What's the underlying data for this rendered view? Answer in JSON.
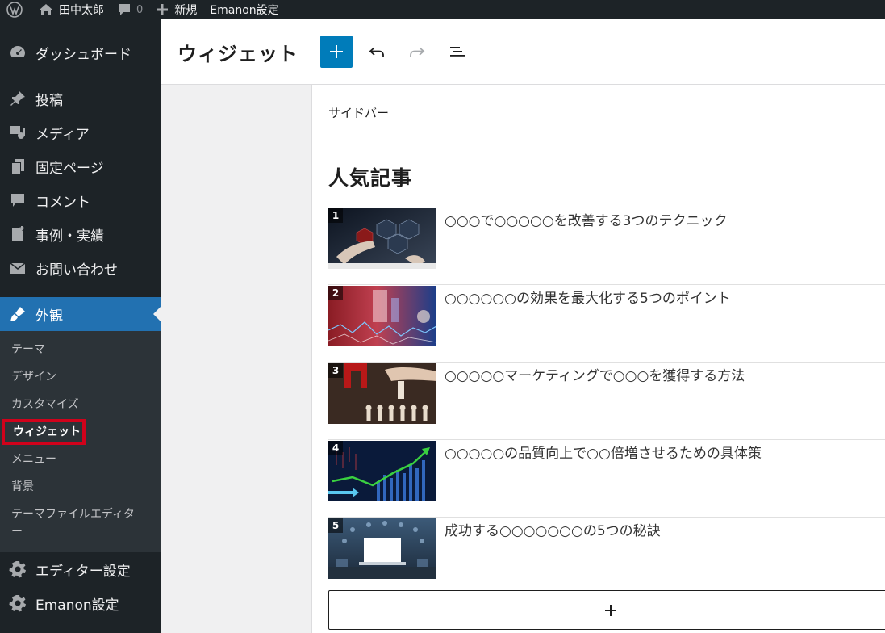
{
  "adminbar": {
    "site_name": "田中太郎",
    "comments_count": "0",
    "new_label": "新規",
    "settings_label": "Emanon設定"
  },
  "sidebar": {
    "items": [
      {
        "label": "ダッシュボード",
        "icon": "dashboard-icon"
      },
      {
        "label": "投稿",
        "icon": "pin-icon"
      },
      {
        "label": "メディア",
        "icon": "media-icon"
      },
      {
        "label": "固定ページ",
        "icon": "page-icon"
      },
      {
        "label": "コメント",
        "icon": "comment-icon"
      },
      {
        "label": "事例・実績",
        "icon": "document-icon"
      },
      {
        "label": "お問い合わせ",
        "icon": "mail-icon"
      },
      {
        "label": "外観",
        "icon": "paintbrush-icon"
      },
      {
        "label": "エディター設定",
        "icon": "gear-icon"
      },
      {
        "label": "Emanon設定",
        "icon": "gear-icon"
      }
    ],
    "submenu": [
      "テーマ",
      "デザイン",
      "カスタマイズ",
      "ウィジェット",
      "メニュー",
      "背景",
      "テーマファイルエディター"
    ]
  },
  "header": {
    "title": "ウィジェット"
  },
  "canvas": {
    "area_label": "サイドバー",
    "widget_title": "人気記事",
    "posts": [
      {
        "rank": "1",
        "title": "○○○で○○○○○を改善する3つのテクニック"
      },
      {
        "rank": "2",
        "title": "○○○○○○の効果を最大化する5つのポイント"
      },
      {
        "rank": "3",
        "title": "○○○○○マーケティングで○○○を獲得する方法"
      },
      {
        "rank": "4",
        "title": "○○○○○の品質向上で○○倍増させるための具体策"
      },
      {
        "rank": "5",
        "title": "成功する○○○○○○○の5つの秘訣"
      }
    ]
  },
  "colors": {
    "admin_dark": "#1d2327",
    "accent": "#2271b1",
    "add_button": "#007cba",
    "highlight": "#d0021b"
  }
}
